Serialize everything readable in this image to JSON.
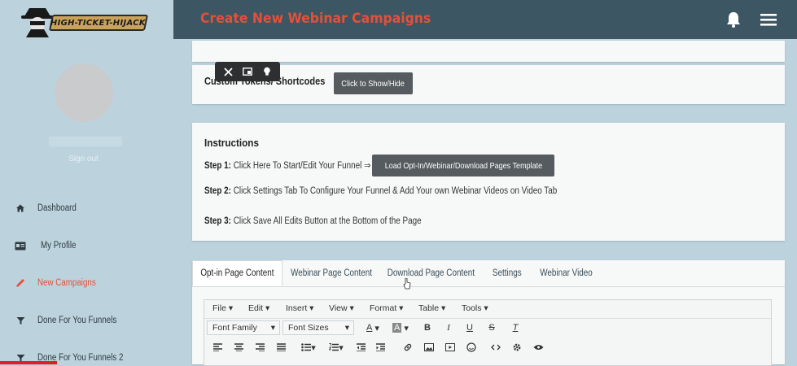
{
  "app": {
    "logo_text": "HIGH-TICKET-HIJACK",
    "page_title": "Create New Webinar Campaigns",
    "accent_color": "#e4503a",
    "topbar_color": "#3c5664",
    "icons": {
      "notifications": "bell-icon",
      "menu": "hamburger-icon"
    }
  },
  "sidebar": {
    "sign_out": "Sign out",
    "items": [
      {
        "label": "Dashboard",
        "icon": "home-icon",
        "active": false
      },
      {
        "label": "My Profile",
        "icon": "id-card-icon",
        "active": false
      },
      {
        "label": "New Campaigns",
        "icon": "pencil-icon",
        "active": true
      },
      {
        "label": "Done For You Funnels",
        "icon": "filter-icon",
        "active": false
      },
      {
        "label": "Done For You Funnels 2",
        "icon": "filter-icon",
        "active": false
      }
    ]
  },
  "tokens": {
    "label": "Custom Tokens/ Shortcodes",
    "button": "Click to Show/Hide"
  },
  "floating_toolbar": {
    "icons": [
      "close-icon",
      "window-icon",
      "lightbulb-icon"
    ]
  },
  "instructions": {
    "title": "Instructions",
    "step1_prefix": "Step 1:",
    "step1_text": "Click Here To Start/Edit Your Funnel ⇒",
    "step1_button": "Load Opt-In/Webinar/Download Pages Template",
    "step2_prefix": "Step 2:",
    "step2_text": "Click Settings Tab To Configure Your Funnel & Add Your own Webinar Videos on Video Tab",
    "step3_prefix": "Step 3:",
    "step3_text": "Click Save All Edits Button at the Bottom of the Page"
  },
  "tabs": [
    {
      "label": "Opt-in Page Content",
      "active": true
    },
    {
      "label": "Webinar Page Content",
      "active": false
    },
    {
      "label": "Download Page Content",
      "active": false
    },
    {
      "label": "Settings",
      "active": false
    },
    {
      "label": "Webinar Video",
      "active": false
    }
  ],
  "editor": {
    "menus": [
      "File",
      "Edit",
      "Insert",
      "View",
      "Format",
      "Table",
      "Tools"
    ],
    "font_family": "Font Family",
    "font_sizes": "Font Sizes",
    "bold": "B",
    "italic": "I",
    "underline": "U",
    "strikethrough": "S",
    "clear_format": "T",
    "text_color": "A",
    "bg_color": "A",
    "toolbar2_icons": [
      "align-left-icon",
      "align-center-icon",
      "align-right-icon",
      "align-justify-icon",
      "bullet-list-icon",
      "numbered-list-icon",
      "outdent-icon",
      "indent-icon",
      "link-icon",
      "image-icon",
      "media-icon",
      "emoticon-icon",
      "code-icon",
      "settings-icon",
      "preview-icon"
    ]
  }
}
